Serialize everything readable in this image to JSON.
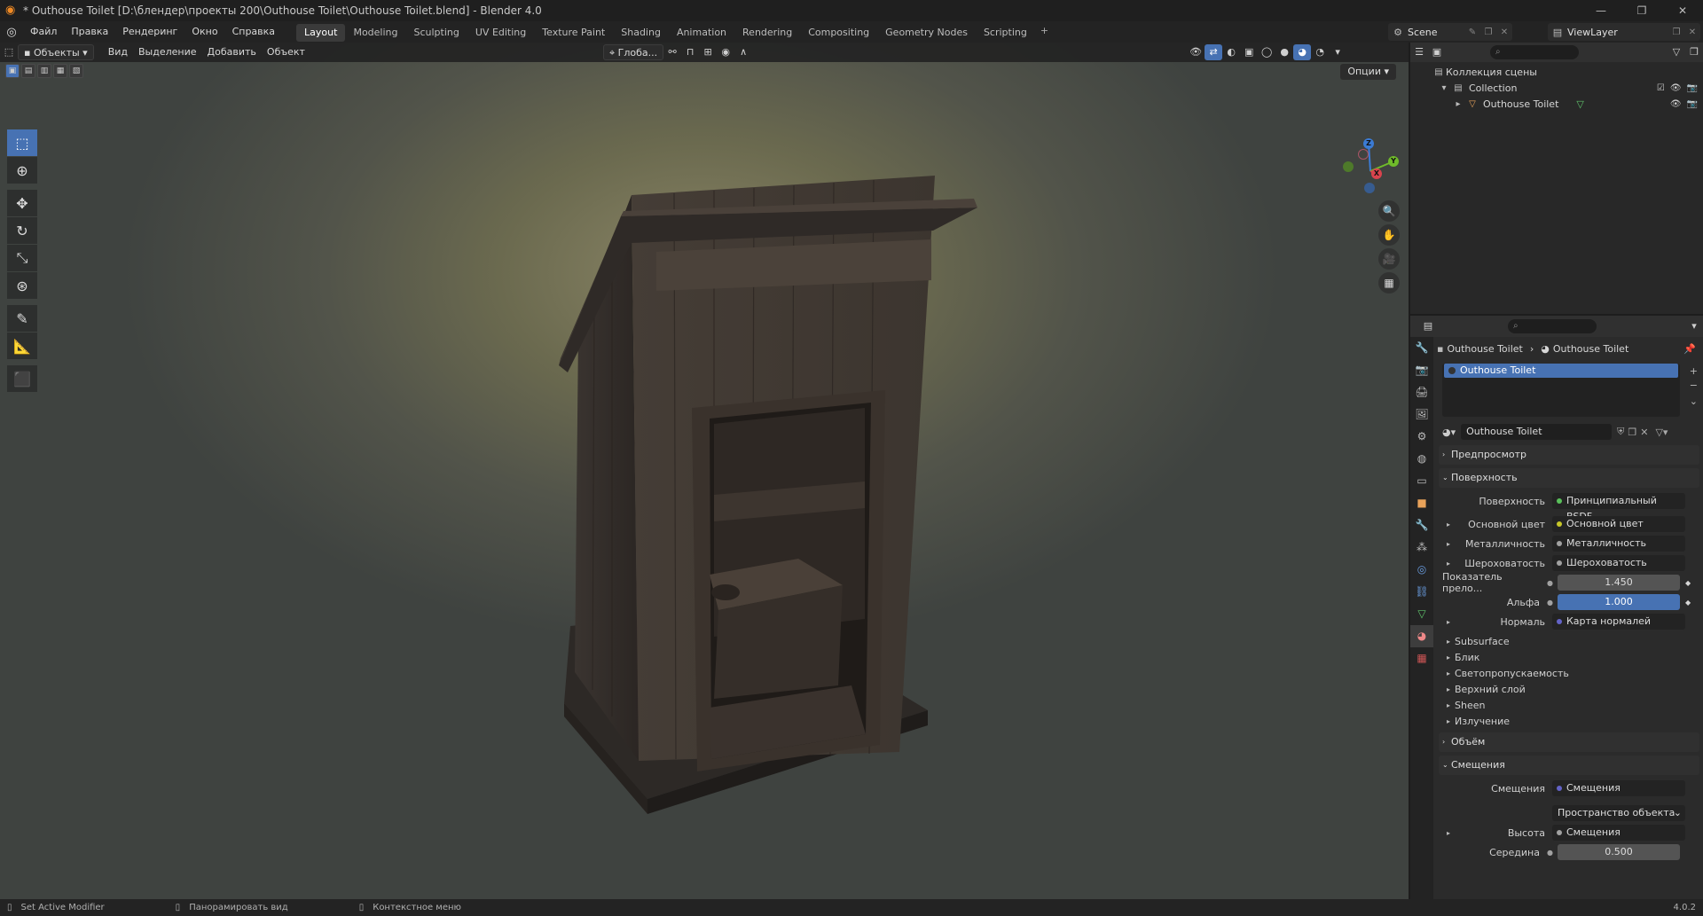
{
  "window": {
    "title": "* Outhouse Toilet [D:\\блендер\\проекты 200\\Outhouse Toilet\\Outhouse Toilet.blend] - Blender 4.0",
    "minimize": "—",
    "maximize": "❐",
    "close": "✕"
  },
  "menu": [
    "Файл",
    "Правка",
    "Рендеринг",
    "Окно",
    "Справка"
  ],
  "workspaces": [
    "Layout",
    "Modeling",
    "Sculpting",
    "UV Editing",
    "Texture Paint",
    "Shading",
    "Animation",
    "Rendering",
    "Compositing",
    "Geometry Nodes",
    "Scripting"
  ],
  "workspace_add": "+",
  "scene": {
    "label": "Scene"
  },
  "view_layer": {
    "label": "ViewLayer"
  },
  "viewport": {
    "mode": "Объекты",
    "menus": [
      "Вид",
      "Выделение",
      "Добавить",
      "Объект"
    ],
    "transform": "Глоба...",
    "options": "Опции",
    "gizmo": {
      "x": "X",
      "y": "Y",
      "z": "Z"
    }
  },
  "outliner": {
    "scene_collection": "Коллекция сцены",
    "collection": "Collection",
    "object": "Outhouse Toilet"
  },
  "properties": {
    "breadcrumb_object": "Outhouse Toilet",
    "breadcrumb_material": "Outhouse Toilet",
    "slot": "Outhouse Toilet",
    "material_name": "Outhouse Toilet",
    "panels": {
      "preview": "Предпросмотр",
      "surface": "Поверхность",
      "volume": "Объём",
      "displacement": "Смещения"
    },
    "surface_rows": [
      {
        "label": "Поверхность",
        "value": "Принципиальный BSDF",
        "dot": "#59c05a"
      },
      {
        "label": "Основной цвет",
        "value": "Основной цвет",
        "dot": "#c7c729",
        "tri": "▸"
      },
      {
        "label": "Металличность",
        "value": "Металличность",
        "dot": "#a1a1a1",
        "tri": "▸"
      },
      {
        "label": "Шероховатость",
        "value": "Шероховатость",
        "dot": "#a1a1a1",
        "tri": "▸"
      }
    ],
    "ior": {
      "label": "Показатель прело...",
      "value": "1.450"
    },
    "alpha": {
      "label": "Альфа",
      "value": "1.000"
    },
    "normal": {
      "label": "Нормаль",
      "value": "Карта нормалей"
    },
    "sub_panels": [
      "Subsurface",
      "Блик",
      "Светопропускаемость",
      "Верхний слой",
      "Sheen",
      "Излучение"
    ],
    "displacement_rows": {
      "disp_label": "Смещения",
      "disp_value": "Смещения",
      "space": "Пространство объекта",
      "height_label": "Высота",
      "height_value": "Смещения",
      "mid_label": "Середина",
      "mid_value": "0.500"
    }
  },
  "status": {
    "left": "Set Active Modifier",
    "middle": "Панорамировать вид",
    "right": "Контекстное меню",
    "version": "4.0.2"
  }
}
